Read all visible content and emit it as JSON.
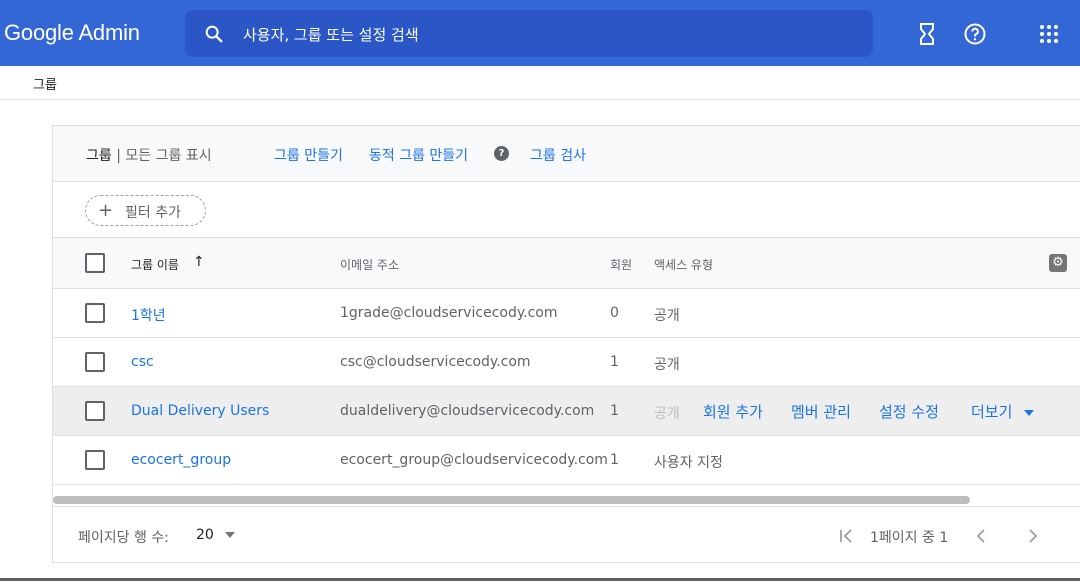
{
  "header": {
    "logo": "Google Admin",
    "search_placeholder": "사용자, 그룹 또는 설정 검색"
  },
  "breadcrumb": "그룹",
  "card": {
    "title_strong": "그룹",
    "title_sep": " | ",
    "title_rest": "모든 그룹 표시",
    "create_group": "그룹 만들기",
    "create_dynamic_group": "동적 그룹 만들기",
    "help": "?",
    "inspect_groups": "그룹 검사"
  },
  "filter": {
    "add_filter": "필터 추가"
  },
  "table": {
    "headers": {
      "name": "그룹 이름",
      "sort": "↑",
      "email": "이메일 주소",
      "members": "회원",
      "access": "액세스 유형"
    },
    "rows": [
      {
        "name": "1학년",
        "email": "1grade@cloudservicecody.com",
        "members": "0",
        "access": "공개"
      },
      {
        "name": "csc",
        "email": "csc@cloudservicecody.com",
        "members": "1",
        "access": "공개"
      },
      {
        "name": "Dual Delivery Users",
        "email": "dualdelivery@cloudservicecody.com",
        "members": "1",
        "access": "공개"
      },
      {
        "name": "ecocert_group",
        "email": "ecocert_group@cloudservicecody.com",
        "members": "1",
        "access": "사용자 지정"
      }
    ],
    "row_actions": {
      "add_member": "회원 추가",
      "manage_members": "멤버 관리",
      "edit_settings": "설정 수정",
      "more": "더보기"
    }
  },
  "footer": {
    "rows_per_page_label": "페이지당 행 수:",
    "rows_per_page_value": "20",
    "page_info": "1페이지 중 1"
  },
  "colors": {
    "topbar": "#3367d6",
    "link": "#1a73e8"
  }
}
